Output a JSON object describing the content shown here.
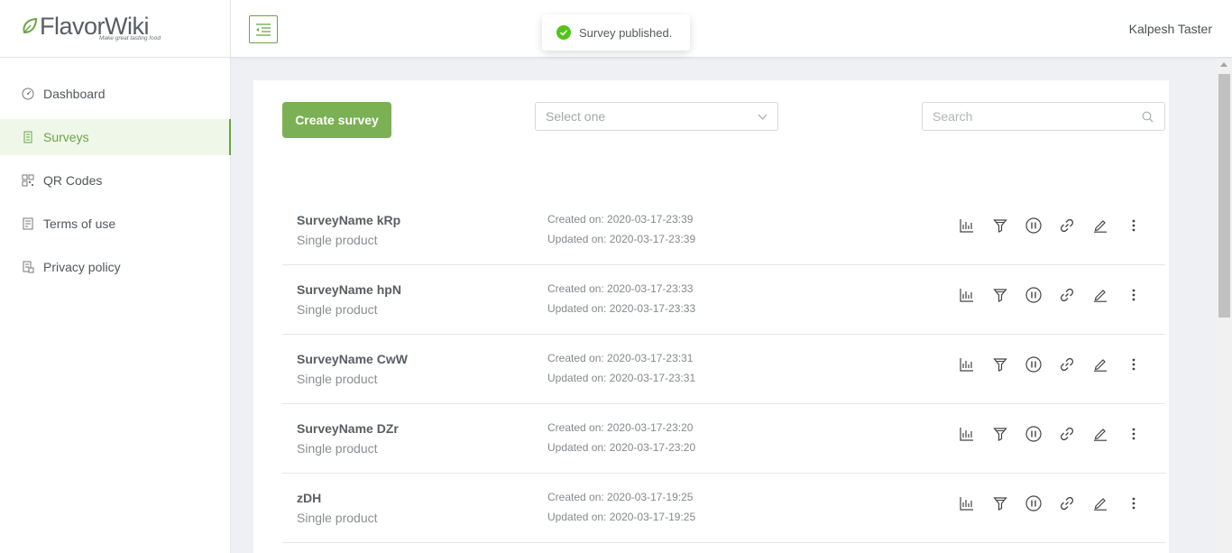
{
  "brand": {
    "logo_text": "FlavorWiki",
    "tagline": "Make great tasting food",
    "accent": "#6ba545"
  },
  "sidebar": {
    "items": [
      {
        "label": "Dashboard",
        "icon": "dashboard-icon",
        "active": false
      },
      {
        "label": "Surveys",
        "icon": "survey-icon",
        "active": true
      },
      {
        "label": "QR Codes",
        "icon": "qr-code-icon",
        "active": false
      },
      {
        "label": "Terms of use",
        "icon": "document-icon",
        "active": false
      },
      {
        "label": "Privacy policy",
        "icon": "privacy-icon",
        "active": false
      }
    ]
  },
  "header": {
    "user_name": "Kalpesh Taster"
  },
  "toast": {
    "message": "Survey published.",
    "color": "#52c41a"
  },
  "toolbar": {
    "create_label": "Create survey",
    "select_placeholder": "Select one",
    "search_placeholder": "Search"
  },
  "surveys": [
    {
      "name": "SurveyName kRp",
      "type": "Single product",
      "created": "Created on: 2020-03-17-23:39",
      "updated": "Updated on: 2020-03-17-23:39"
    },
    {
      "name": "SurveyName hpN",
      "type": "Single product",
      "created": "Created on: 2020-03-17-23:33",
      "updated": "Updated on: 2020-03-17-23:33"
    },
    {
      "name": "SurveyName CwW",
      "type": "Single product",
      "created": "Created on: 2020-03-17-23:31",
      "updated": "Updated on: 2020-03-17-23:31"
    },
    {
      "name": "SurveyName DZr",
      "type": "Single product",
      "created": "Created on: 2020-03-17-23:20",
      "updated": "Updated on: 2020-03-17-23:20"
    },
    {
      "name": "zDH",
      "type": "Single product",
      "created": "Created on: 2020-03-17-19:25",
      "updated": "Updated on: 2020-03-17-19:25"
    }
  ],
  "row_actions": [
    "stats-icon",
    "filter-icon",
    "pause-icon",
    "link-icon",
    "edit-icon",
    "more-icon"
  ]
}
